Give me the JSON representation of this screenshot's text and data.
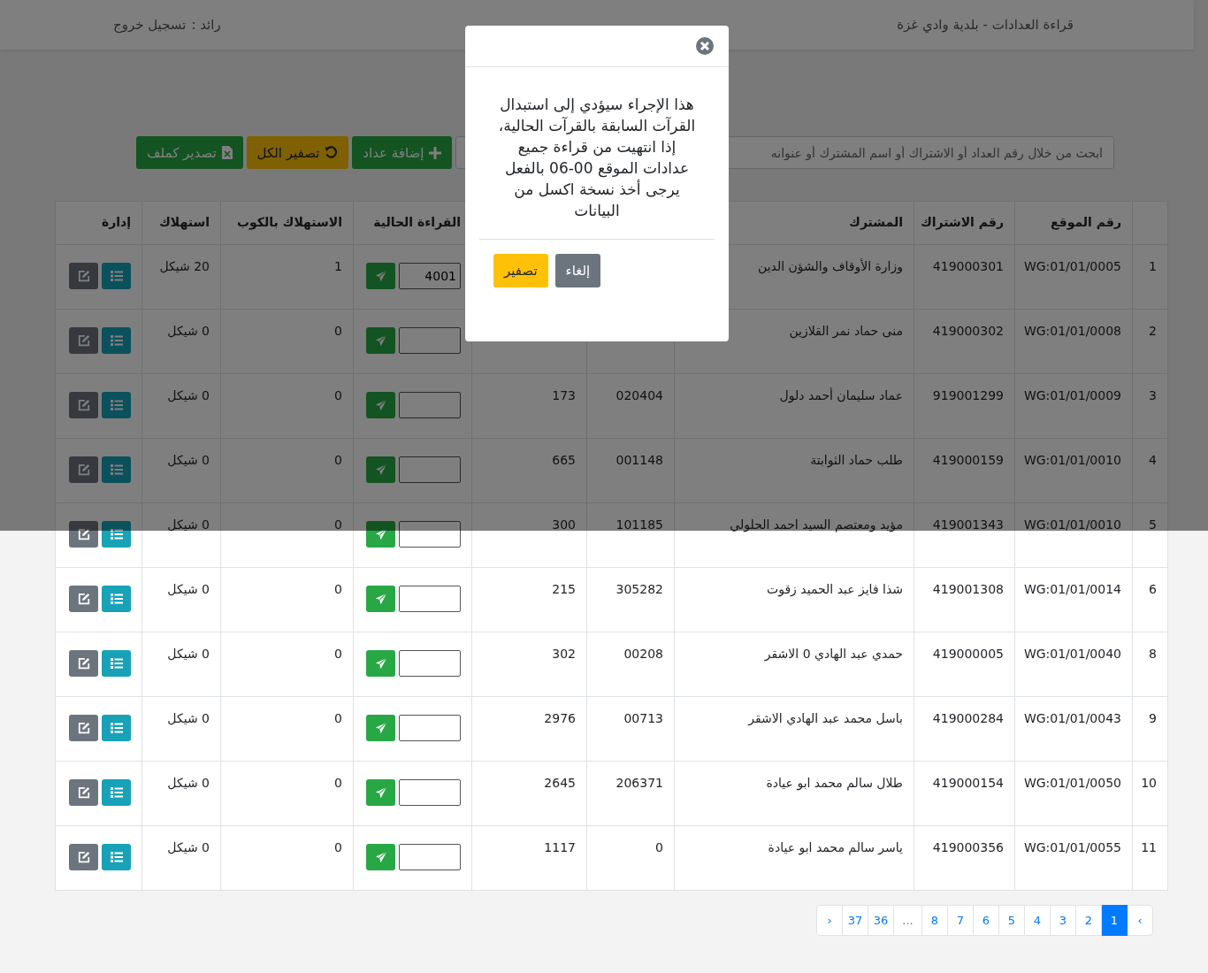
{
  "header": {
    "title": "قراءة العدادات - بلدية وادي غزة",
    "user": "رائد :",
    "logout": "تسجيل خروج"
  },
  "toolbar": {
    "search": {
      "placeholder": "ابحث من خلال رقم العداد أو الاشتراك أو اسم المشترك أو عنوانه"
    },
    "buttons": [
      {
        "kind": "add",
        "label": "إضافة عداد"
      },
      {
        "kind": "reset",
        "label": "تصفير الكل"
      },
      {
        "kind": "export",
        "label": "تصدير كملف"
      }
    ]
  },
  "table": {
    "headings": {
      "site": "رقم الموقع",
      "subscription": "رقم الاشتراك",
      "subscriber": "المشترك",
      "current_reading": "القراءة الحالية",
      "consumption_m3": "الاستهلاك بالكوب",
      "consumption": "استهلاك",
      "actions": "إدارة"
    },
    "rows": [
      {
        "index": "1",
        "site": "WG:01/01/0005",
        "subscription": "419000301",
        "subscriber": "وزارة الأوقاف والشؤن الدين",
        "reading": "4001",
        "consumption_m3": "1",
        "consumption": "20 شيكل"
      },
      {
        "index": "2",
        "site": "WG:01/01/0008",
        "subscription": "419000302",
        "subscriber": "منى حماد نمر القلازين",
        "consumption_m3": "0",
        "consumption": "0 شيكل"
      },
      {
        "index": "3",
        "site": "WG:01/01/0009",
        "subscription": "919001299",
        "subscriber": "عماد سليمان أحمد دلول",
        "column_5": "020404",
        "column_6": "173",
        "consumption_m3": "0",
        "consumption": "0 شيكل"
      },
      {
        "index": "4",
        "site": "WG:01/01/0010",
        "subscription": "419000159",
        "subscriber": "طلب حماد الثوابتة",
        "column_5": "001148",
        "column_6": "665",
        "consumption_m3": "0",
        "consumption": "0 شيكل"
      },
      {
        "index": "5",
        "site": "WG:01/01/0010",
        "subscription": "419001343",
        "subscriber": "مؤيد ومعتصم السيد احمد الحلولي",
        "column_5": "101185",
        "column_6": "300",
        "consumption_m3": "0",
        "consumption": "0 شيكل"
      },
      {
        "index": "6",
        "site": "WG:01/01/0014",
        "subscription": "419001308",
        "subscriber": "شذا فايز عبد الحميد زقوت",
        "column_5": "305282",
        "column_6": "215",
        "consumption_m3": "0",
        "consumption": "0 شيكل"
      },
      {
        "index": "8",
        "site": "WG:01/01/0040",
        "subscription": "419000005",
        "subscriber": "حمدي عبد الهادي 0 الاشقر",
        "column_5": "00208",
        "column_6": "302",
        "consumption_m3": "0",
        "consumption": "0 شيكل"
      },
      {
        "index": "9",
        "site": "WG:01/01/0043",
        "subscription": "419000284",
        "subscriber": "باسل محمد عبد الهادي الاشقر",
        "column_5": "00713",
        "column_6": "2976",
        "consumption_m3": "0",
        "consumption": "0 شيكل"
      },
      {
        "index": "10",
        "site": "WG:01/01/0050",
        "subscription": "419000154",
        "subscriber": "طلال سالم محمد ابو عيادة",
        "column_5": "206371",
        "column_6": "2645",
        "consumption_m3": "0",
        "consumption": "0 شيكل"
      },
      {
        "index": "11",
        "site": "WG:01/01/0055",
        "subscription": "419000356",
        "subscriber": "ياسر سالم محمد ابو عيادة",
        "column_5": "0",
        "column_6": "1117",
        "consumption_m3": "0",
        "consumption": "0 شيكل"
      }
    ]
  },
  "pagination": [
    {
      "label": "›",
      "kind": "arrow",
      "selected": false
    },
    {
      "label": "1",
      "kind": "page",
      "selected": true
    },
    {
      "label": "2",
      "kind": "page",
      "selected": false
    },
    {
      "label": "3",
      "kind": "page",
      "selected": false
    },
    {
      "label": "4",
      "kind": "page",
      "selected": false
    },
    {
      "label": "5",
      "kind": "page",
      "selected": false
    },
    {
      "label": "6",
      "kind": "page",
      "selected": false
    },
    {
      "label": "7",
      "kind": "page",
      "selected": false
    },
    {
      "label": "8",
      "kind": "page",
      "selected": false
    },
    {
      "label": "...",
      "kind": "gap",
      "selected": false
    },
    {
      "label": "36",
      "kind": "page",
      "selected": false
    },
    {
      "label": "37",
      "kind": "page",
      "selected": false
    },
    {
      "label": "‹",
      "kind": "arrow",
      "selected": false
    }
  ],
  "modal": {
    "message": "هذا الإجراء سيؤدي إلى استبدال القرآت السابقة بالقرآت الحالية، إذا انتهيت من قراءة جميع عدادات الموقع 00-06 بالفعل يرجى أخذ نسخة اكسل من البيانات",
    "buttons": [
      {
        "kind": "cancel",
        "label": "إلغاء"
      },
      {
        "kind": "confirm",
        "label": "تصفير"
      }
    ]
  }
}
